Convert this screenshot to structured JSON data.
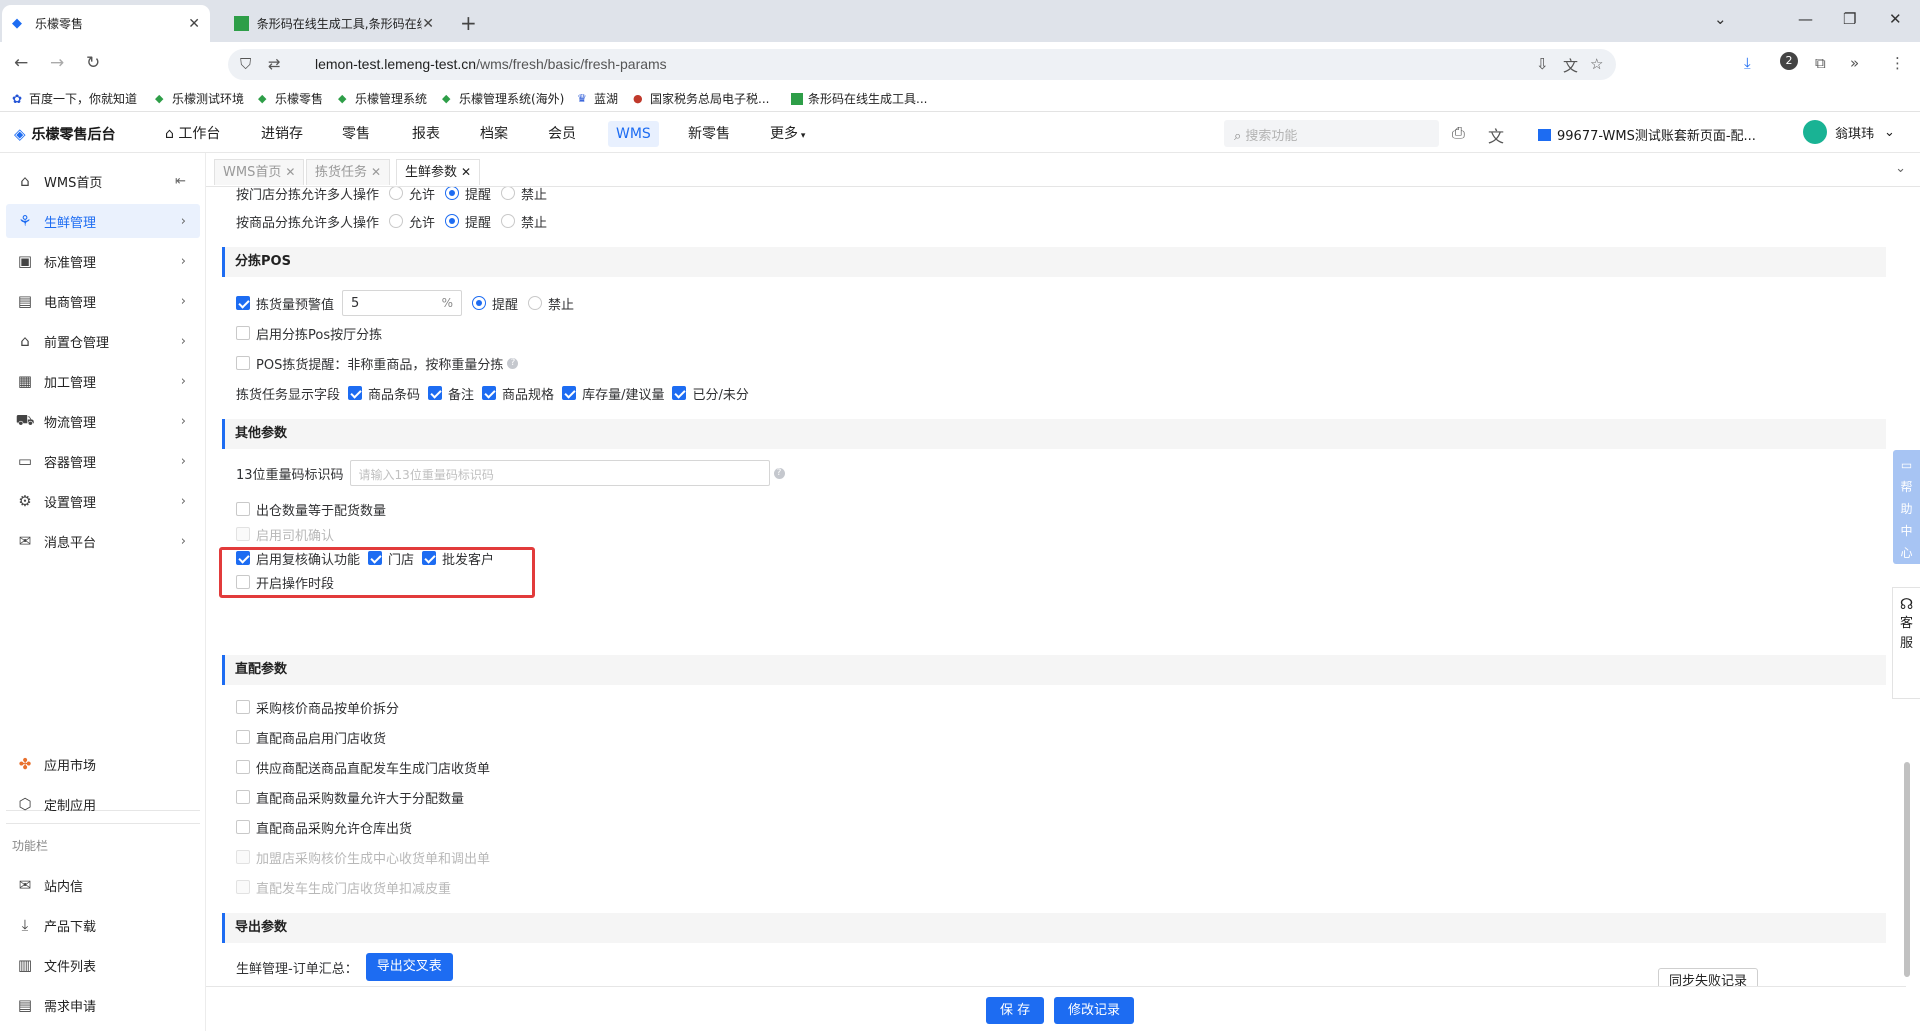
{
  "browser": {
    "tabs": [
      {
        "title": "乐檬零售",
        "active": true
      },
      {
        "title": "条形码在线生成工具,条形码在线",
        "active": false
      }
    ],
    "url_host": "lemon-test.lemeng-test.cn",
    "url_path": "/wms/fresh/basic/fresh-params",
    "profile_badge": "2",
    "bookmarks": [
      "百度一下，你就知道",
      "乐檬测试环境",
      "乐檬零售",
      "乐檬管理系统",
      "乐檬管理系统(海外)",
      "蓝湖",
      "国家税务总局电子税...",
      "条形码在线生成工具..."
    ]
  },
  "header": {
    "logo": "乐檬零售后台",
    "nav": [
      "工作台",
      "进销存",
      "零售",
      "报表",
      "档案",
      "会员",
      "WMS",
      "新零售",
      "更多"
    ],
    "active_nav": "WMS",
    "search_placeholder": "搜索功能",
    "store": "99677-WMS测试账套新页面-配...",
    "user": "翁琪玮"
  },
  "sidebar": {
    "items": [
      {
        "label": "WMS首页",
        "icon": "home-icon"
      },
      {
        "label": "生鲜管理",
        "icon": "fresh-icon",
        "active": true
      },
      {
        "label": "标准管理",
        "icon": "standard-icon"
      },
      {
        "label": "电商管理",
        "icon": "ecommerce-icon"
      },
      {
        "label": "前置仓管理",
        "icon": "warehouse-icon"
      },
      {
        "label": "加工管理",
        "icon": "process-icon"
      },
      {
        "label": "物流管理",
        "icon": "logistics-icon"
      },
      {
        "label": "容器管理",
        "icon": "container-icon"
      },
      {
        "label": "设置管理",
        "icon": "settings-icon"
      },
      {
        "label": "消息平台",
        "icon": "message-icon"
      }
    ],
    "bottom_items": [
      {
        "label": "应用市场",
        "icon": "app-market-icon"
      },
      {
        "label": "定制应用",
        "icon": "custom-app-icon"
      }
    ],
    "section_caption": "功能栏",
    "function_items": [
      {
        "label": "站内信",
        "icon": "mail-icon"
      },
      {
        "label": "产品下载",
        "icon": "download-icon"
      },
      {
        "label": "文件列表",
        "icon": "file-list-icon"
      },
      {
        "label": "需求申请",
        "icon": "request-icon"
      }
    ]
  },
  "page_tabs": [
    {
      "label": "WMS首页"
    },
    {
      "label": "拣货任务"
    },
    {
      "label": "生鲜参数",
      "active": true
    }
  ],
  "content": {
    "row_store_multi": {
      "label": "按门店分拣允许多人操作",
      "options": [
        "允许",
        "提醒",
        "禁止"
      ],
      "selected": "提醒"
    },
    "row_goods_multi": {
      "label": "按商品分拣允许多人操作",
      "options": [
        "允许",
        "提醒",
        "禁止"
      ],
      "selected": "提醒"
    },
    "sec_pos": "分拣POS",
    "pick_warn": {
      "label": "拣货量预警值",
      "value": "5",
      "unit": "%",
      "options": [
        "提醒",
        "禁止"
      ],
      "selected": "提醒",
      "checked": true
    },
    "pos_hall": {
      "label": "启用分拣Pos按厅分拣",
      "checked": false
    },
    "pos_tip": {
      "label": "POS拣货提醒：非称重商品，按称重量分拣",
      "checked": false
    },
    "display_fields": {
      "label": "拣货任务显示字段",
      "fields": [
        "商品条码",
        "备注",
        "商品规格",
        "库存量/建议量",
        "已分/未分"
      ]
    },
    "sec_other": "其他参数",
    "barcode13": {
      "label": "13位重量码标识码",
      "placeholder": "请输入13位重量码标识码"
    },
    "out_equal": {
      "label": "出仓数量等于配货数量",
      "checked": false
    },
    "driver_confirm": {
      "label": "启用司机确认",
      "checked": false,
      "disabled": true
    },
    "review": {
      "label": "启用复核确认功能",
      "checked": true,
      "store": "门店",
      "wholesale": "批发客户"
    },
    "op_period": {
      "label": "开启操作时段",
      "checked": false
    },
    "sec_direct": "直配参数",
    "direct_items": [
      {
        "label": "采购核价商品按单价拆分",
        "disabled": false
      },
      {
        "label": "直配商品启用门店收货",
        "disabled": false
      },
      {
        "label": "供应商配送商品直配发车生成门店收货单",
        "disabled": false
      },
      {
        "label": "直配商品采购数量允许大于分配数量",
        "disabled": false
      },
      {
        "label": "直配商品采购允许仓库出货",
        "disabled": false
      },
      {
        "label": "加盟店采购核价生成中心收货单和调出单",
        "disabled": true
      },
      {
        "label": "直配发车生成门店收货单扣减皮重",
        "disabled": true
      }
    ],
    "sec_export": "导出参数",
    "export_row": {
      "label": "生鲜管理-订单汇总：",
      "button": "导出交叉表"
    }
  },
  "footer": {
    "save": "保 存",
    "history": "修改记录",
    "sync_fail": "同步失败记录"
  },
  "float": {
    "help": [
      "帮",
      "助",
      "中",
      "心"
    ],
    "service": [
      "客",
      "服"
    ]
  }
}
